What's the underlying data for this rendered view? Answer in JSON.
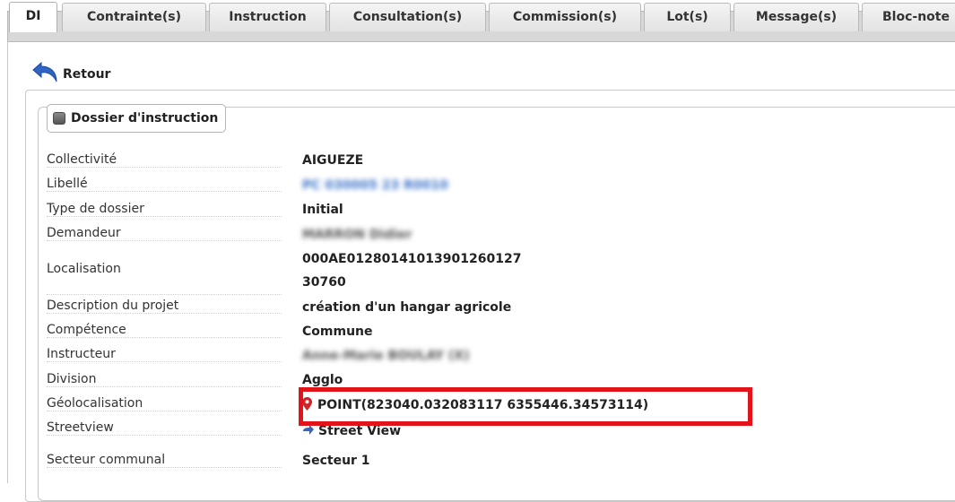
{
  "tabs": [
    {
      "label": "DI",
      "active": true
    },
    {
      "label": "Contrainte(s)"
    },
    {
      "label": "Instruction"
    },
    {
      "label": "Consultation(s)"
    },
    {
      "label": "Commission(s)"
    },
    {
      "label": "Lot(s)"
    },
    {
      "label": "Message(s)"
    },
    {
      "label": "Bloc-note"
    }
  ],
  "retour_label": "Retour",
  "section_title": "Dossier d'instruction",
  "fields": {
    "collectivite": {
      "label": "Collectivité",
      "value": "AIGUEZE"
    },
    "libelle": {
      "label": "Libellé",
      "value": "PC 030005 23 R0010"
    },
    "type_dossier": {
      "label": "Type de dossier",
      "value": "Initial"
    },
    "demandeur": {
      "label": "Demandeur",
      "value": "MARRON Didier"
    },
    "localisation": {
      "label": "Localisation",
      "line1": "000AE0128014101390126012​7",
      "line2": "30760"
    },
    "description": {
      "label": "Description du projet",
      "value": "création d'un hangar agricole"
    },
    "competence": {
      "label": "Compétence",
      "value": "Commune"
    },
    "instructeur": {
      "label": "Instructeur",
      "value": "Anne-Marie BOULAY (X)"
    },
    "division": {
      "label": "Division",
      "value": "Agglo"
    },
    "geolocalisation": {
      "label": "Géolocalisation",
      "value": "POINT(823040.032083117 6355446.34573114)"
    },
    "streetview": {
      "label": "Streetview",
      "value": "Street View"
    },
    "secteur": {
      "label": "Secteur communal",
      "value": "Secteur 1"
    }
  },
  "colors": {
    "highlight_border": "#e3131a",
    "pin": "#d2232a",
    "arrow": "#3d63b7",
    "retour_icon": "#2f63c4"
  }
}
